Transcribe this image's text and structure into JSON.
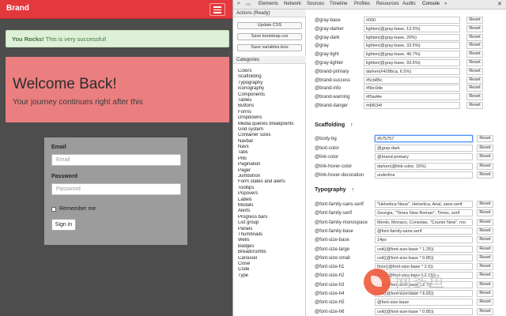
{
  "preview": {
    "brand": "Brand",
    "alert": {
      "strong": "You Rocks!",
      "text": " This is very successful!"
    },
    "jumbotron": {
      "title": "Welcome Back!",
      "subtitle": "Your journey continues right after this"
    },
    "form": {
      "email_label": "Email",
      "email_placeholder": "Email",
      "password_label": "Password",
      "password_placeholder": "Password",
      "remember_label": "Remember me",
      "signin_label": "Sign in"
    }
  },
  "devtools": {
    "tabs": [
      "Elements",
      "Network",
      "Sources",
      "Timeline",
      "Profiles",
      "Resources",
      "Audits",
      "Console",
      "»"
    ],
    "close_label": "✕",
    "actions": {
      "header": "Actions (Ready)",
      "buttons": [
        "Update CSS",
        "Save bootstrap.css",
        "Save variables.less"
      ]
    },
    "categories": {
      "header": "Categories",
      "items": [
        "Colors",
        "Scaffolding",
        "Typography",
        "Iconography",
        "Components",
        "Tables",
        "Buttons",
        "Forms",
        "Dropdowns",
        "Media queries breakpoints",
        "Grid system",
        "Container sizes",
        "Navbar",
        "Navs",
        "Tabs",
        "Pills",
        "Pagination",
        "Pager",
        "Jumbotron",
        "Form states and alerts",
        "Tooltips",
        "Popovers",
        "Labels",
        "Modals",
        "Alerts",
        "Progress bars",
        "List group",
        "Panels",
        "Thumbnails",
        "Wells",
        "Badges",
        "Breadcrumbs",
        "Carousel",
        "Close",
        "Code",
        "Type"
      ]
    },
    "reset_label": "Reset",
    "colors": [
      {
        "name": "@gray-base",
        "value": "#000"
      },
      {
        "name": "@gray-darker",
        "value": "lighten(@gray-base, 13.5%)"
      },
      {
        "name": "@gray-dark",
        "value": "lighten(@gray-base, 20%)"
      },
      {
        "name": "@gray",
        "value": "lighten(@gray-base, 33.5%)"
      },
      {
        "name": "@gray-light",
        "value": "lighten(@gray-base, 46.7%)"
      },
      {
        "name": "@gray-lighter",
        "value": "lighten(@gray-base, 93.5%)"
      },
      {
        "name": "@brand-primary",
        "value": "darken(#428bca, 6.5%)"
      },
      {
        "name": "@brand-success",
        "value": "#5cb85c"
      },
      {
        "name": "@brand-info",
        "value": "#5bc0de"
      },
      {
        "name": "@brand-warning",
        "value": "#f0ad4e"
      },
      {
        "name": "@brand-danger",
        "value": "#d9534f"
      }
    ],
    "scaffolding": {
      "header": "Scaffolding",
      "arrow": "↑",
      "rows": [
        {
          "name": "@body-bg",
          "value": "#575757"
        },
        {
          "name": "@text-color",
          "value": "@gray-dark"
        },
        {
          "name": "@link-color",
          "value": "@brand-primary"
        },
        {
          "name": "@link-hover-color",
          "value": "darken(@link-color, 15%)"
        },
        {
          "name": "@link-hover-decoration",
          "value": "underline"
        }
      ]
    },
    "typography": {
      "header": "Typography",
      "arrow": "↑",
      "rows": [
        {
          "name": "@font-family-sans-serif",
          "value": "\"Helvetica Neue\", Helvetica, Arial, sans-serif"
        },
        {
          "name": "@font-family-serif",
          "value": "Georgia, \"Times New Roman\", Times, serif"
        },
        {
          "name": "@font-family-monospace",
          "value": "Menlo, Monaco, Consolas, \"Courier New\", mo"
        },
        {
          "name": "@font-family-base",
          "value": "@font-family-sans-serif"
        },
        {
          "name": "@font-size-base",
          "value": "14px"
        },
        {
          "name": "@font-size-large",
          "value": "ceil((@font-size-base * 1.25))"
        },
        {
          "name": "@font-size-small",
          "value": "ceil((@font-size-base * 0.85))"
        },
        {
          "name": "@font-size-h1",
          "value": "floor((@font-size-base * 2.6))"
        },
        {
          "name": "@font-size-h2",
          "value": "floor((@font-size-base * 2.15))"
        },
        {
          "name": "@font-size-h3",
          "value": "ceil((@font-size-base * 1.7))"
        },
        {
          "name": "@font-size-h4",
          "value": "ceil((@font-size-base * 1.25))"
        },
        {
          "name": "@font-size-h5",
          "value": "@font-size-base"
        },
        {
          "name": "@font-size-h6",
          "value": "ceil((@font-size-base * 0.85))"
        }
      ]
    }
  },
  "watermark": {
    "cn": "网多鱼",
    "en": "wduoyu.com"
  },
  "colors": {
    "navbar": "#e4393c",
    "alert_bg": "#dff0d8",
    "jumbotron_bg": "#eb7f7f",
    "body_bg": "#4d4d4d",
    "focus": "#4d90fe"
  }
}
